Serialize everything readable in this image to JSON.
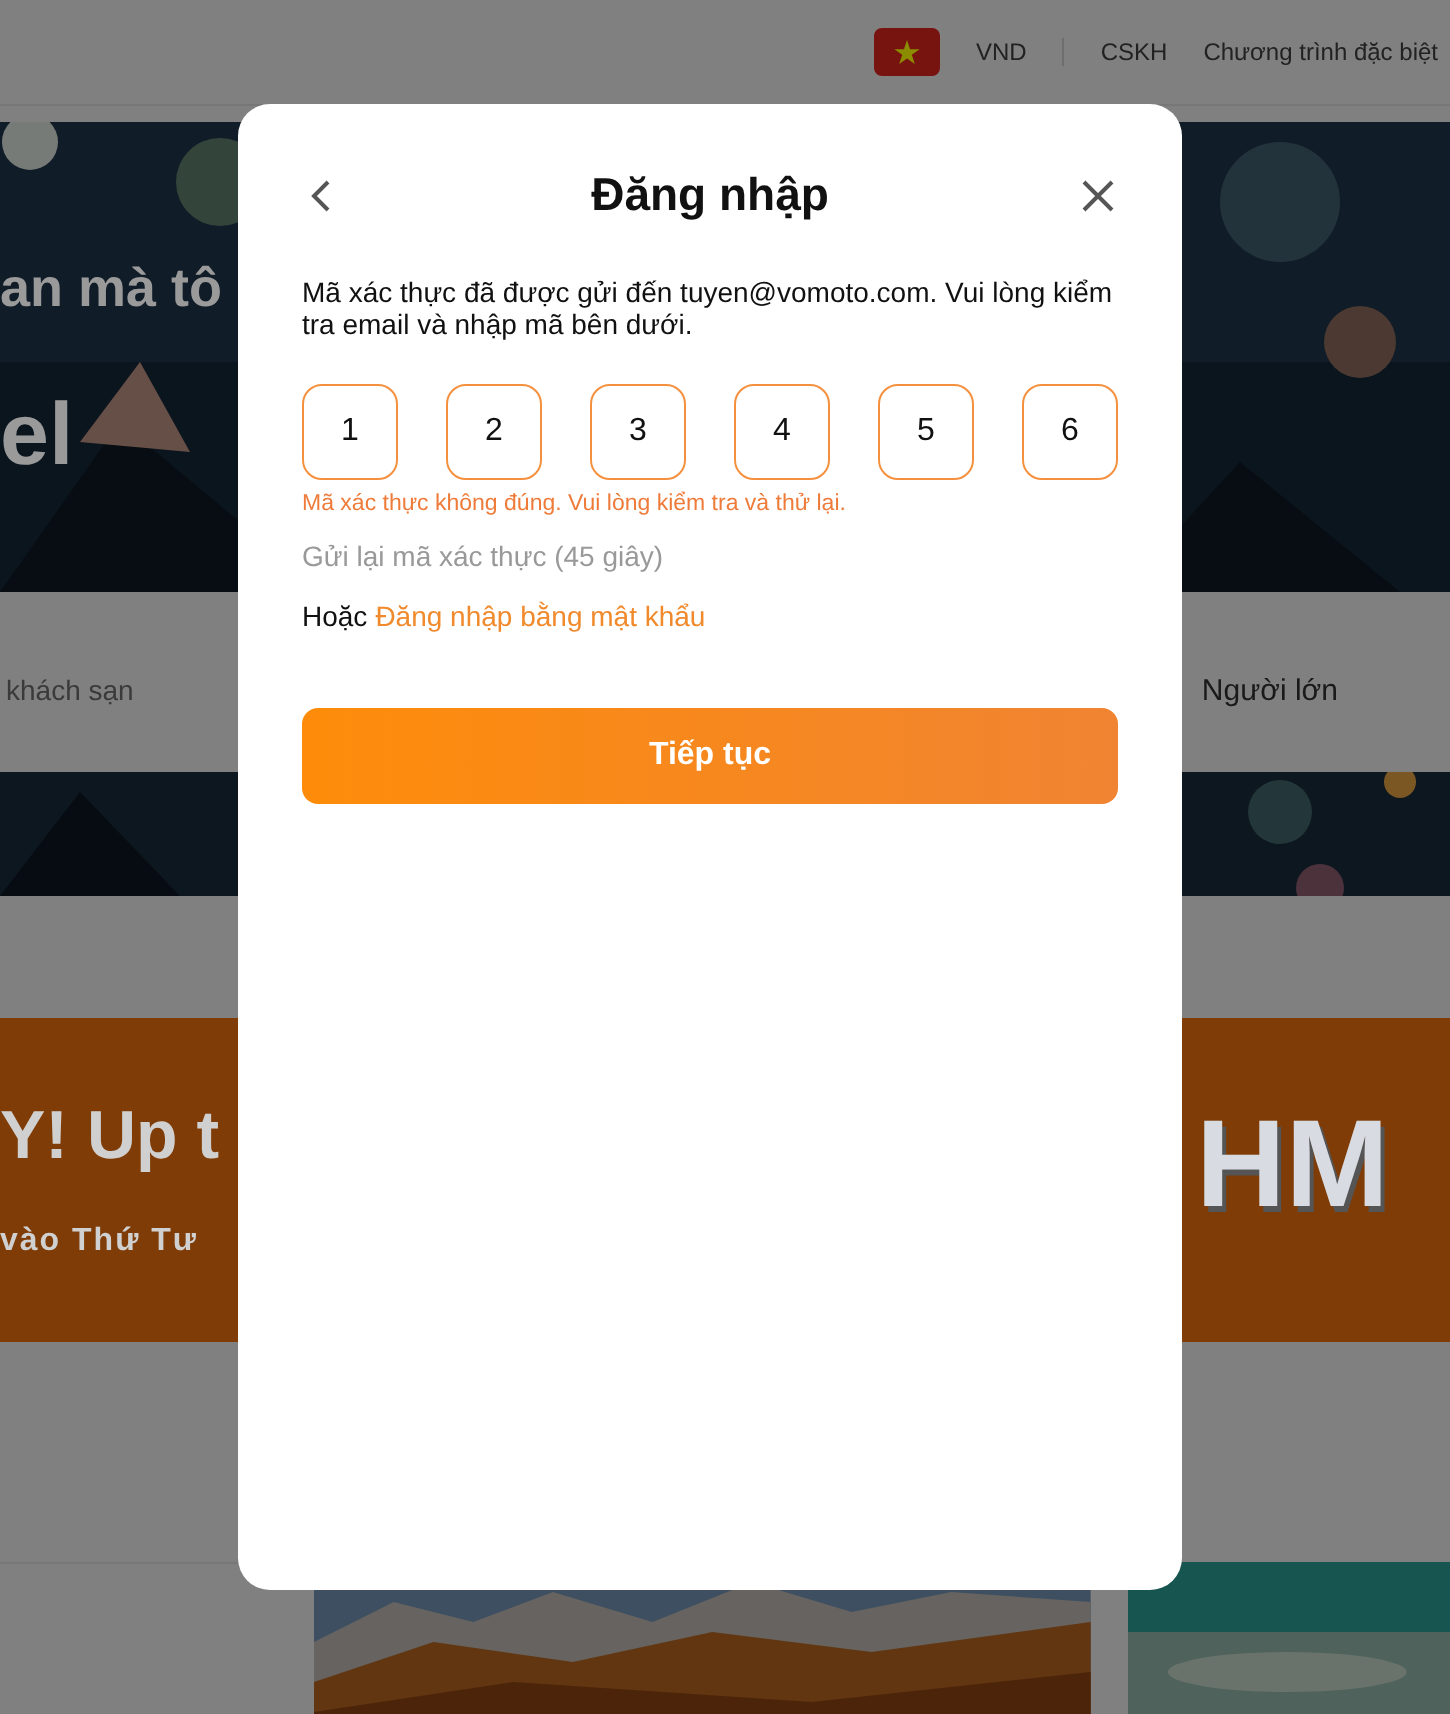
{
  "background": {
    "header": {
      "currency": "VND",
      "links": [
        "CSKH",
        "Chương trình đặc biệt"
      ]
    },
    "hero": {
      "line_1": "an mà tô",
      "line_2": "el"
    },
    "search_bar": {
      "destination": "khách sạn",
      "guests": "Người lớn"
    },
    "promo_banner": {
      "headline": "Y! Up t",
      "subline": "vào Thứ Tư",
      "brand_text": "HM"
    }
  },
  "modal": {
    "title": "Đăng nhập",
    "message": "Mã xác thực đã được gửi đến tuyen@vomoto.com. Vui lòng kiểm tra email và nhập mã bên dưới.",
    "code_digits": [
      "1",
      "2",
      "3",
      "4",
      "5",
      "6"
    ],
    "error": "Mã xác thực không đúng. Vui lòng kiểm tra và thử lại.",
    "resend": {
      "label": "Gửi lại mã xác thực (45 giây)",
      "disabled": true
    },
    "alternative": {
      "prefix": "Hoặc",
      "link": "Đăng nhập bằng mật khẩu"
    },
    "submit": "Tiếp tục"
  }
}
